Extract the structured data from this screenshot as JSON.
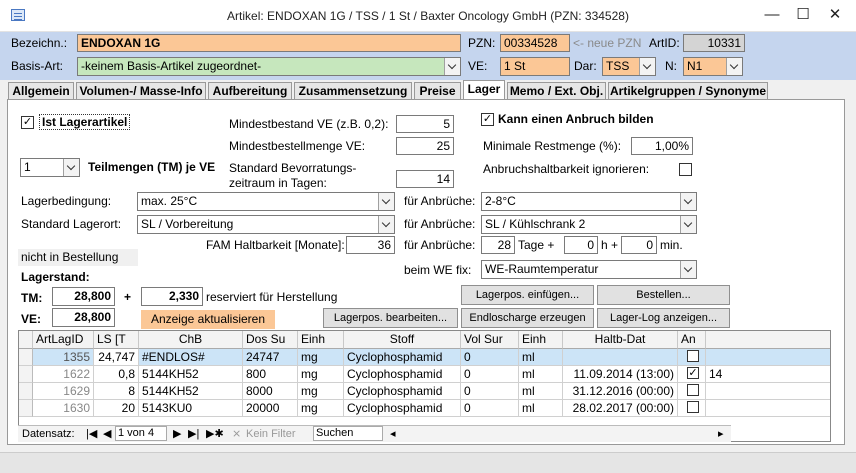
{
  "window": {
    "title": "Artikel: ENDOXAN 1G / TSS / 1 St / Baxter Oncology GmbH (PZN: 334528)",
    "minimize": "—",
    "maximize": "☐",
    "close": "✕"
  },
  "header": {
    "bezeichn_label": "Bezeichn.:",
    "bezeichn_value": "ENDOXAN 1G",
    "basisart_label": "Basis-Art:",
    "basisart_value": "-keinem Basis-Artikel zugeordnet-",
    "pzn_label": "PZN:",
    "pzn_value": "00334528",
    "pzn_hint": "<- neue PZN",
    "artid_label": "ArtID:",
    "artid_value": "10331",
    "ve_label": "VE:",
    "ve_value": "1 St",
    "dar_label": "Dar:",
    "dar_value": "TSS",
    "n_label": "N:",
    "n_value": "N1"
  },
  "tabs": [
    {
      "label": "Allgemein"
    },
    {
      "label": "Volumen-/ Masse-Info"
    },
    {
      "label": "Aufbereitung"
    },
    {
      "label": "Zusammensetzung"
    },
    {
      "label": "Preise"
    },
    {
      "label": "Lager"
    },
    {
      "label": "Memo / Ext. Obj."
    },
    {
      "label": "Artikelgruppen / Synonyme"
    }
  ],
  "lager": {
    "ist_lagerartikel_label": "Ist Lagerartikel",
    "ist_lagerartikel_checked": "✓",
    "teilmengen_value": "1",
    "teilmengen_label": "Teilmengen (TM) je VE",
    "mindestbestand_label": "Mindestbestand VE (z.B. 0,2):",
    "mindestbestand_value": "5",
    "mindestbestellmenge_label": "Mindestbestellmenge VE:",
    "mindestbestellmenge_value": "25",
    "bevorratung_label_1": "Standard Bevorratungs-",
    "bevorratung_label_2": "zeitraum in Tagen:",
    "bevorratung_value": "14",
    "anbruch_label": "Kann einen Anbruch bilden",
    "anbruch_checked": "✓",
    "restmenge_label": "Minimale Restmenge (%):",
    "restmenge_value": "1,00%",
    "anbruchshaltbarkeit_label": "Anbruchshaltbarkeit ignorieren:",
    "lagerbedingung_label": "Lagerbedingung:",
    "lagerbedingung_value": "max. 25°C",
    "lagerort_label": "Standard Lagerort:",
    "lagerort_value": "SL / Vorbereitung",
    "fam_label": "FAM Haltbarkeit [Monate]:",
    "fam_value": "36",
    "fuer_anbrueche_label": "für Anbrüche:",
    "anbruch_bedingung_value": "2-8°C",
    "anbruch_lagerort_value": "SL / Kühlschrank 2",
    "anbruch_tage_value": "28",
    "tage_label": "Tage +",
    "anbruch_h_value": "0",
    "h_label": "h +",
    "anbruch_min_value": "0",
    "min_label": "min.",
    "we_fix_label": "beim WE fix:",
    "we_fix_value": "WE-Raumtemperatur",
    "nicht_bestellung": "nicht in Bestellung",
    "lagerstand_label": "Lagerstand:",
    "tm_label": "TM:",
    "tm_value": "28,800",
    "plus": "+",
    "reserviert_value": "2,330",
    "reserviert_label": "reserviert für Herstellung",
    "ve_label": "VE:",
    "ve_value": "28,800",
    "anzeige_button": "Anzeige aktualisieren",
    "lagerpos_einfuegen": "Lagerpos. einfügen...",
    "bestellen": "Bestellen...",
    "lagerpos_bearbeiten": "Lagerpos. bearbeiten...",
    "endloscharge": "Endloscharge erzeugen",
    "lager_log": "Lager-Log anzeigen..."
  },
  "grid": {
    "columns": [
      "ArtLagID",
      "LS [T",
      "ChB",
      "Dos Su",
      "Einh",
      "Stoff",
      "Vol Sur",
      "Einh",
      "Haltb-Dat",
      "An"
    ],
    "rows": [
      {
        "id": "1355",
        "ls": "24,747",
        "chb": "#ENDLOS#",
        "dos": "24747",
        "einh": "mg",
        "stoff": "Cyclophosphamid",
        "vol": "0",
        "einh2": "ml",
        "haltb": "",
        "an": "",
        "extra": ""
      },
      {
        "id": "1622",
        "ls": "0,8",
        "chb": "5144KH52",
        "dos": "800",
        "einh": "mg",
        "stoff": "Cyclophosphamid",
        "vol": "0",
        "einh2": "ml",
        "haltb": "11.09.2014 (13:00)",
        "an": "✓",
        "extra": "14"
      },
      {
        "id": "1629",
        "ls": "8",
        "chb": "5144KH52",
        "dos": "8000",
        "einh": "mg",
        "stoff": "Cyclophosphamid",
        "vol": "0",
        "einh2": "ml",
        "haltb": "31.12.2016 (00:00)",
        "an": "",
        "extra": ""
      },
      {
        "id": "1630",
        "ls": "20",
        "chb": "5143KU0",
        "dos": "20000",
        "einh": "mg",
        "stoff": "Cyclophosphamid",
        "vol": "0",
        "einh2": "ml",
        "haltb": "28.02.2017 (00:00)",
        "an": "",
        "extra": ""
      }
    ]
  },
  "nav": {
    "datensatz": "Datensatz:",
    "position": "1 von 4",
    "first": "|◀",
    "prev": "◀",
    "next": "▶",
    "last": "▶|",
    "new": "▶✱",
    "kein_filter": "Kein Filter",
    "search_placeholder": "Suchen"
  },
  "colors": {
    "header_bg": "#c5d5ee",
    "orange_field": "#fbc796",
    "green_field": "#c6e7bd",
    "selected_row": "#cce4f7"
  }
}
